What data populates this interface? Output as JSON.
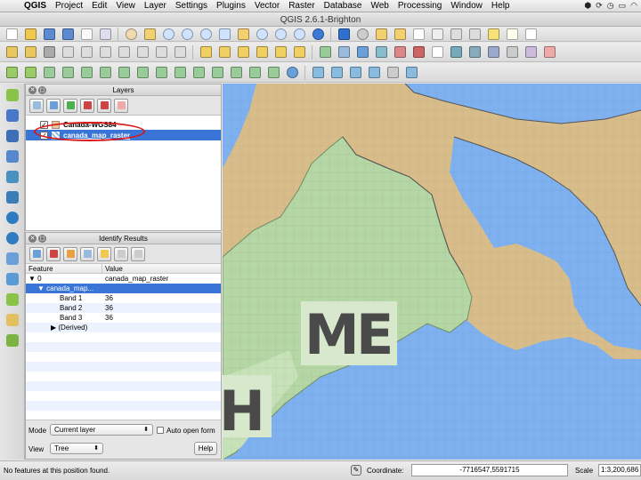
{
  "menubar": {
    "items": [
      "QGIS",
      "Project",
      "Edit",
      "View",
      "Layer",
      "Settings",
      "Plugins",
      "Vector",
      "Raster",
      "Database",
      "Web",
      "Processing",
      "Window",
      "Help"
    ]
  },
  "window": {
    "title": "QGIS 2.6.1-Brighton"
  },
  "layers_panel": {
    "title": "Layers",
    "layers": [
      {
        "name": "Canada-WGS84",
        "checked": true,
        "selected": false
      },
      {
        "name": "canada_map_raster",
        "checked": true,
        "selected": true
      }
    ]
  },
  "identify_panel": {
    "title": "Identify Results",
    "headers": {
      "feature": "Feature",
      "value": "Value"
    },
    "rows": [
      {
        "feature": "▼ 0",
        "value": "canada_map_raster",
        "indent": 0,
        "selected": false
      },
      {
        "feature": "▼ canada_map...",
        "value": "",
        "indent": 1,
        "selected": true
      },
      {
        "feature": "Band 1",
        "value": "36",
        "indent": 2,
        "selected": false
      },
      {
        "feature": "Band 2",
        "value": "36",
        "indent": 2,
        "selected": false
      },
      {
        "feature": "Band 3",
        "value": "36",
        "indent": 2,
        "selected": false
      },
      {
        "feature": "▶ (Derived)",
        "value": "",
        "indent": 2,
        "selected": false
      }
    ],
    "mode_label": "Mode",
    "mode_value": "Current layer",
    "auto_open_label": "Auto open form",
    "view_label": "View",
    "view_value": "Tree",
    "help_label": "Help"
  },
  "map": {
    "labels": [
      "M",
      "E",
      "H"
    ],
    "colors": {
      "land": "#d8bd8b",
      "water": "#7fb1f0",
      "green": "#b5d6a5"
    }
  },
  "statusbar": {
    "message": "No features at this position found.",
    "coordinate_label": "Coordinate:",
    "coordinate_value": "-7716547,5591715",
    "scale_label": "Scale",
    "scale_value": "1:3,200,686"
  }
}
